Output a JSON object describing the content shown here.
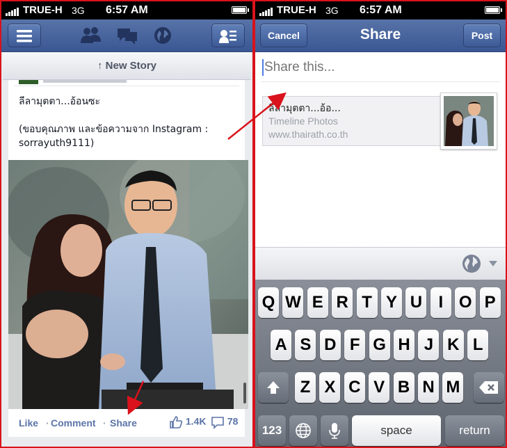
{
  "left": {
    "status": {
      "carrier": "TRUE-H",
      "network": "3G",
      "time": "6:57 AM"
    },
    "navbar": {
      "menu_icon": "menu-icon",
      "friends_icon": "friend-requests-icon",
      "messages_icon": "messages-icon",
      "notifications_icon": "globe-icon",
      "contacts_icon": "contacts-icon"
    },
    "new_story_label": "New Story",
    "post": {
      "text_line1": "ลีลามุตตา...อ้อนซะ",
      "text_line2": "(ขอบคุณภาพ และข้อความจาก Instagram :",
      "text_line3": "sorrayuth9111)",
      "photo_alt": "photo of two people"
    },
    "actions": {
      "like": "Like",
      "comment": "Comment",
      "share": "Share",
      "separator": "·",
      "likes_count": "1.4K",
      "comments_count": "78"
    }
  },
  "right": {
    "status": {
      "carrier": "TRUE-H",
      "network": "3G",
      "time": "6:57 AM"
    },
    "navbar": {
      "cancel_label": "Cancel",
      "title": "Share",
      "post_label": "Post"
    },
    "composer": {
      "placeholder": "Share this..."
    },
    "link_preview": {
      "title": "ลีลามุตตา...อ้อ...",
      "subtitle": "Timeline Photos",
      "domain": "www.thairath.co.th"
    },
    "audience_icon": "globe-icon",
    "keyboard": {
      "row1": [
        "Q",
        "W",
        "E",
        "R",
        "T",
        "Y",
        "U",
        "I",
        "O",
        "P"
      ],
      "row2": [
        "A",
        "S",
        "D",
        "F",
        "G",
        "H",
        "J",
        "K",
        "L"
      ],
      "row3": [
        "Z",
        "X",
        "C",
        "V",
        "B",
        "N",
        "M"
      ],
      "numbers_label": "123",
      "space_label": "space",
      "return_label": "return"
    }
  },
  "colors": {
    "facebook_blue": "#3b5998",
    "annotation_red": "#d9121b",
    "link_blue": "#5b74a8"
  }
}
